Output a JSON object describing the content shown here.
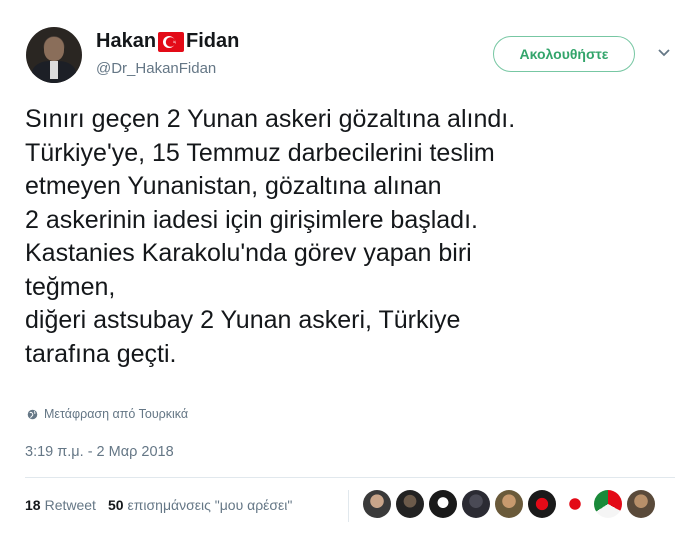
{
  "user": {
    "name_first": "Hakan",
    "name_last": "Fidan",
    "handle": "@Dr_HakanFidan",
    "follow_label": "Ακολουθήστε",
    "flag_icon": "turkey-flag-icon"
  },
  "tweet": {
    "lines": [
      "Sınırı geçen 2 Yunan askeri gözaltına alındı.",
      "Türkiye'ye, 15 Temmuz darbecilerini teslim",
      "etmeyen Yunanistan, gözaltına alınan",
      "2 askerinin iadesi için girişimlere başladı.",
      "Kastanies Karakolu'nda görev yapan biri",
      "teğmen,",
      "diğeri astsubay 2 Yunan askeri, Türkiye",
      "tarafına geçti."
    ],
    "translate_label": "Μετάφραση από Τουρκικά",
    "timestamp": "3:19 π.μ. - 2 Μαρ 2018"
  },
  "stats": {
    "retweet_count": "18",
    "retweet_label": "Retweet",
    "like_count": "50",
    "like_label": "επισημάνσεις \"μου αρέσει\""
  },
  "colors": {
    "follow_border": "#77c7a3",
    "follow_text": "#33a56b",
    "secondary_text": "#657786",
    "flag_red": "#e30a17"
  }
}
